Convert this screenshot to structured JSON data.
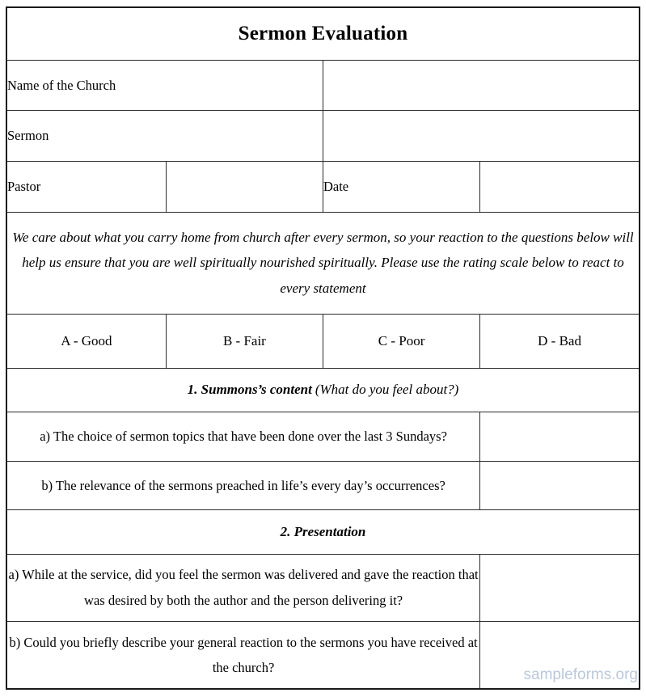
{
  "document": {
    "title": "Sermon Evaluation"
  },
  "fields": [
    {
      "label": "Name of the Church",
      "value": ""
    },
    {
      "label": "Sermon",
      "value": ""
    }
  ],
  "pastor_row": {
    "pastor_label": "Pastor",
    "pastor_value": "",
    "date_label": "Date",
    "date_value": ""
  },
  "intro": {
    "text": "We care about what you carry home from church after every sermon, so your reaction to the questions below will help us ensure that you are well spiritually nourished spiritually. Please use the rating scale below to react to every statement"
  },
  "rating_scale": [
    {
      "label": "A - Good"
    },
    {
      "label": "B - Fair"
    },
    {
      "label": "C - Poor"
    },
    {
      "label": "D - Bad"
    }
  ],
  "sections": [
    {
      "number": "1. Summons’s content",
      "subtitle": "(What do you feel about?)",
      "questions": [
        {
          "text": "a) The choice of sermon topics that have been done over the last 3 Sundays?",
          "answer": ""
        },
        {
          "text": "b) The relevance of the sermons preached in life’s every day’s occurrences?",
          "answer": ""
        }
      ]
    },
    {
      "number": "2. Presentation",
      "subtitle": "",
      "questions": [
        {
          "text": "a) While at the service, did you feel the sermon was delivered and gave the reaction that was desired by both the author and the person delivering it?",
          "answer": ""
        },
        {
          "text": "b) Could you briefly describe your general reaction to the sermons you have received at the church?",
          "answer": ""
        }
      ]
    }
  ],
  "watermark": {
    "text": "sampleforms.org"
  },
  "colors": {
    "header_blue": "#93b5e1",
    "cell_blue": "#cfdff5",
    "border": "#2b2b2b",
    "watermark": "#b9c9dd"
  }
}
